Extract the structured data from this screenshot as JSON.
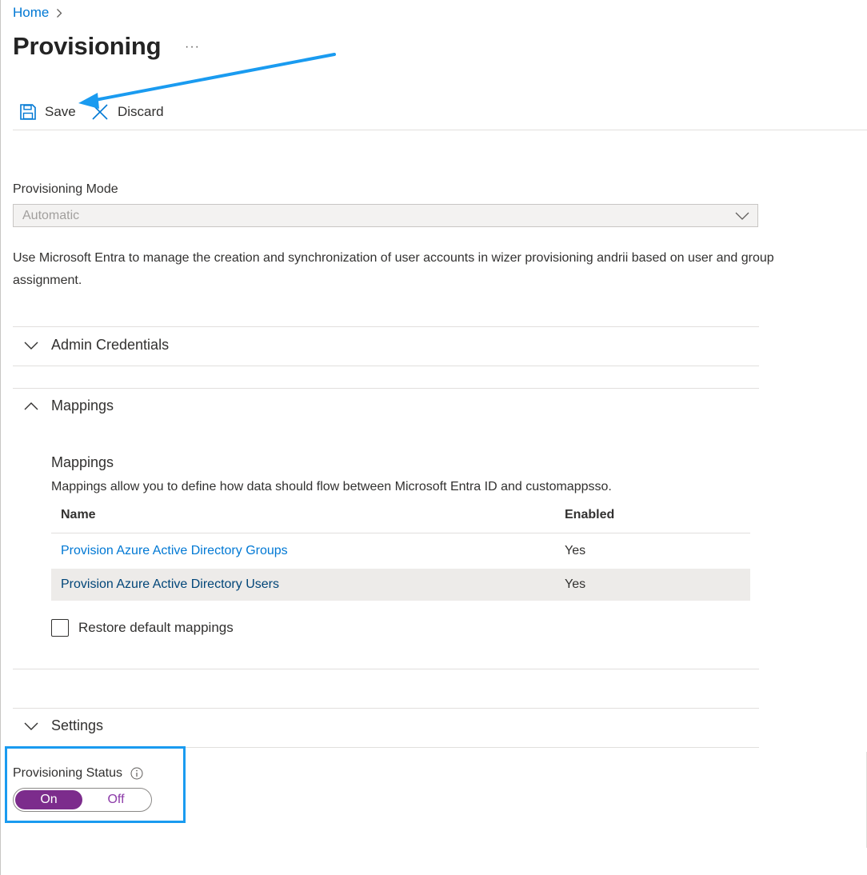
{
  "breadcrumb": {
    "home": "Home"
  },
  "page": {
    "title": "Provisioning",
    "more": "···"
  },
  "toolbar": {
    "save_label": "Save",
    "discard_label": "Discard"
  },
  "provisioning_mode": {
    "label": "Provisioning Mode",
    "value": "Automatic"
  },
  "description": "Use Microsoft Entra to manage the creation and synchronization of user accounts in wizer provisioning andrii based on user and group assignment.",
  "sections": {
    "admin_credentials": {
      "label": "Admin Credentials",
      "expanded": false
    },
    "mappings": {
      "label": "Mappings",
      "expanded": true,
      "subtitle": "Mappings",
      "description": "Mappings allow you to define how data should flow between Microsoft Entra ID and customappsso.",
      "columns": {
        "name": "Name",
        "enabled": "Enabled"
      },
      "rows": [
        {
          "name": "Provision Azure Active Directory Groups",
          "enabled": "Yes"
        },
        {
          "name": "Provision Azure Active Directory Users",
          "enabled": "Yes"
        }
      ],
      "restore_label": "Restore default mappings",
      "restore_checked": false
    },
    "settings": {
      "label": "Settings",
      "expanded": false
    }
  },
  "provisioning_status": {
    "label": "Provisioning Status",
    "on_label": "On",
    "off_label": "Off",
    "state": "On"
  },
  "colors": {
    "accent": "#0078d4",
    "toggle_on": "#7c2c8c",
    "annotation": "#1a9bf0"
  },
  "icons": {
    "save": "floppy-disk-icon",
    "discard": "close-icon",
    "chevron": "chevron-down-icon",
    "chevron_up": "chevron-up-icon",
    "info": "info-icon",
    "breadcrumb_sep": "chevron-right-icon"
  }
}
